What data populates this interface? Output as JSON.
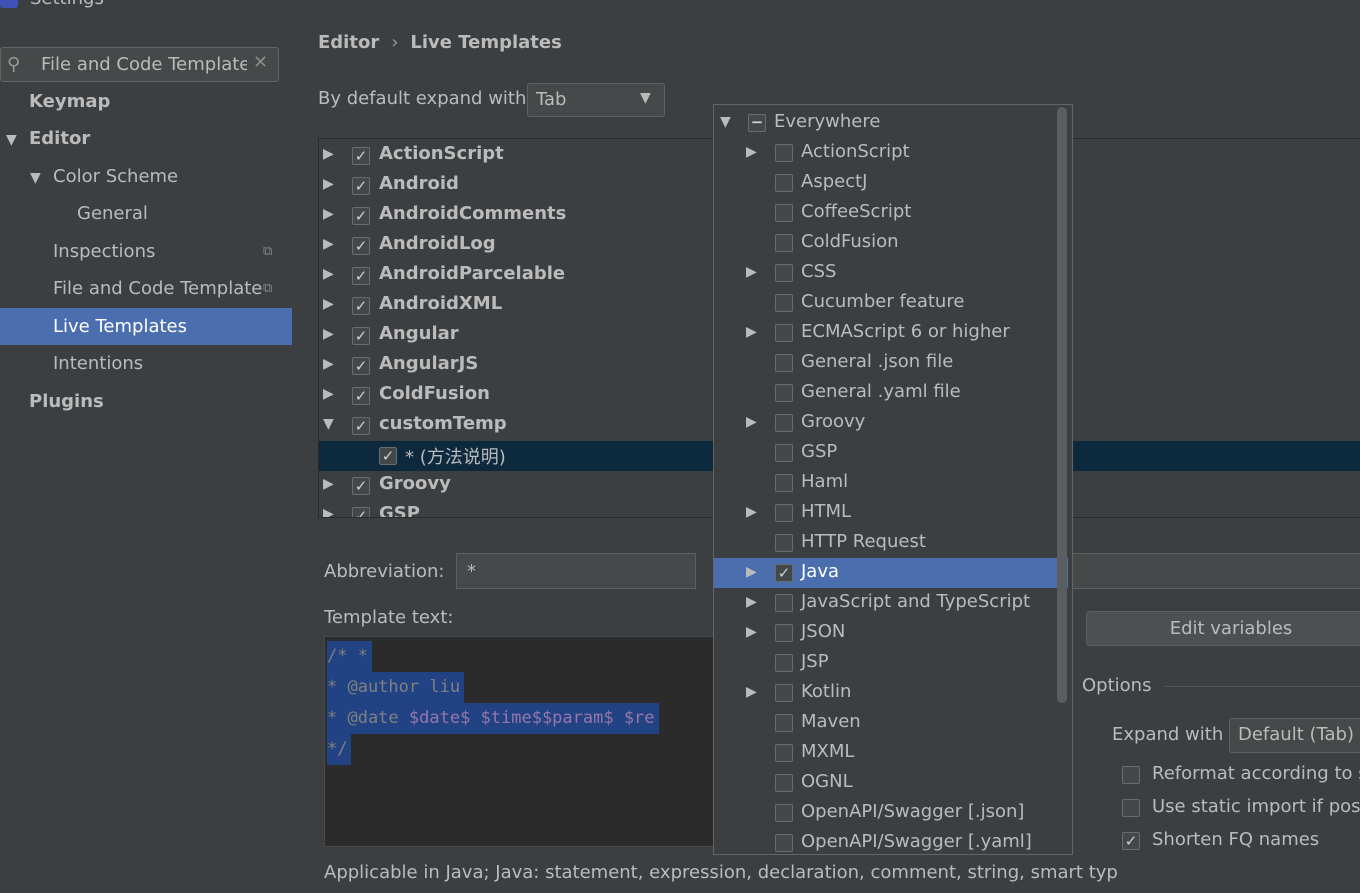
{
  "window": {
    "title": "Settings"
  },
  "search": {
    "value": "File and Code Template"
  },
  "sidebar": {
    "items": [
      {
        "label": "Keymap"
      },
      {
        "label": "Editor"
      },
      {
        "label": "Color Scheme"
      },
      {
        "label": "General"
      },
      {
        "label": "Inspections"
      },
      {
        "label": "File and Code Template"
      },
      {
        "label": "Live Templates"
      },
      {
        "label": "Intentions"
      },
      {
        "label": "Plugins"
      }
    ]
  },
  "breadcrumb": {
    "parent": "Editor",
    "sep": "›",
    "current": "Live Templates"
  },
  "expand": {
    "label": "By default expand with",
    "value": "Tab"
  },
  "tree": {
    "rows": [
      {
        "label": "ActionScript"
      },
      {
        "label": "Android"
      },
      {
        "label": "AndroidComments"
      },
      {
        "label": "AndroidLog"
      },
      {
        "label": "AndroidParcelable"
      },
      {
        "label": "AndroidXML"
      },
      {
        "label": "Angular"
      },
      {
        "label": "AngularJS"
      },
      {
        "label": "ColdFusion"
      },
      {
        "label": "customTemp"
      },
      {
        "label": "* (方法说明)"
      },
      {
        "label": "Groovy"
      },
      {
        "label": "GSP"
      }
    ]
  },
  "abbreviation": {
    "label": "Abbreviation:",
    "value": "*"
  },
  "template_text": {
    "label": "Template text:",
    "lines": [
      "/* *",
      "* @author liu",
      "* @date ",
      "$date$ $time$$param$ $re",
      "*/"
    ]
  },
  "applicable": "Applicable in Java; Java: statement, expression, declaration, comment, string, smart typ",
  "edit_variables": "Edit variables",
  "options": {
    "title": "Options",
    "expand_with_label": "Expand with",
    "expand_with_value": "Default (Tab)",
    "checkboxes": [
      {
        "label": "Reformat according to s",
        "checked": false
      },
      {
        "label": "Use static import if possi",
        "checked": false
      },
      {
        "label": "Shorten FQ names",
        "checked": true
      }
    ]
  },
  "context_popup": {
    "root": "Everywhere",
    "items": [
      {
        "label": "ActionScript"
      },
      {
        "label": "AspectJ"
      },
      {
        "label": "CoffeeScript"
      },
      {
        "label": "ColdFusion"
      },
      {
        "label": "CSS"
      },
      {
        "label": "Cucumber feature"
      },
      {
        "label": "ECMAScript 6 or higher"
      },
      {
        "label": "General .json file"
      },
      {
        "label": "General .yaml file"
      },
      {
        "label": "Groovy"
      },
      {
        "label": "GSP"
      },
      {
        "label": "Haml"
      },
      {
        "label": "HTML"
      },
      {
        "label": "HTTP Request"
      },
      {
        "label": "Java"
      },
      {
        "label": "JavaScript and TypeScript"
      },
      {
        "label": "JSON"
      },
      {
        "label": "JSP"
      },
      {
        "label": "Kotlin"
      },
      {
        "label": "Maven"
      },
      {
        "label": "MXML"
      },
      {
        "label": "OGNL"
      },
      {
        "label": "OpenAPI/Swagger [.json]"
      },
      {
        "label": "OpenAPI/Swagger [.yaml]"
      }
    ]
  },
  "colors": {
    "selection": "#4b6eaf",
    "background": "#3c3f41",
    "editor_bg": "#2b2b2b",
    "code_selection": "#214283"
  }
}
